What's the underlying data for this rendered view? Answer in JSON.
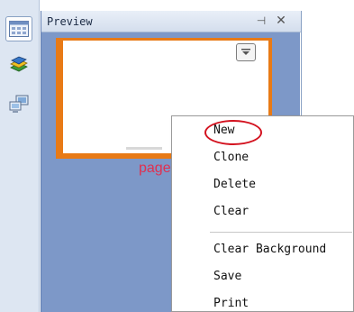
{
  "toolbar": {
    "buttons": [
      {
        "icon": "slide-grid-icon",
        "active": true
      },
      {
        "icon": "book-stack-icon",
        "active": false
      },
      {
        "icon": "computer-network-icon",
        "active": false
      }
    ]
  },
  "panel": {
    "title": "Preview",
    "pin_symbol": "⊣",
    "close_symbol": "✕"
  },
  "thumbnail": {
    "border_color": "#e87a16",
    "page_label": "page"
  },
  "context_menu": {
    "items": [
      {
        "label": "New",
        "highlighted": true
      },
      {
        "label": "Clone"
      },
      {
        "label": "Delete"
      },
      {
        "label": "Clear"
      },
      {
        "label": "Clear Background"
      },
      {
        "label": "Save"
      },
      {
        "label": "Print"
      }
    ],
    "highlight_color": "#d3121f"
  }
}
